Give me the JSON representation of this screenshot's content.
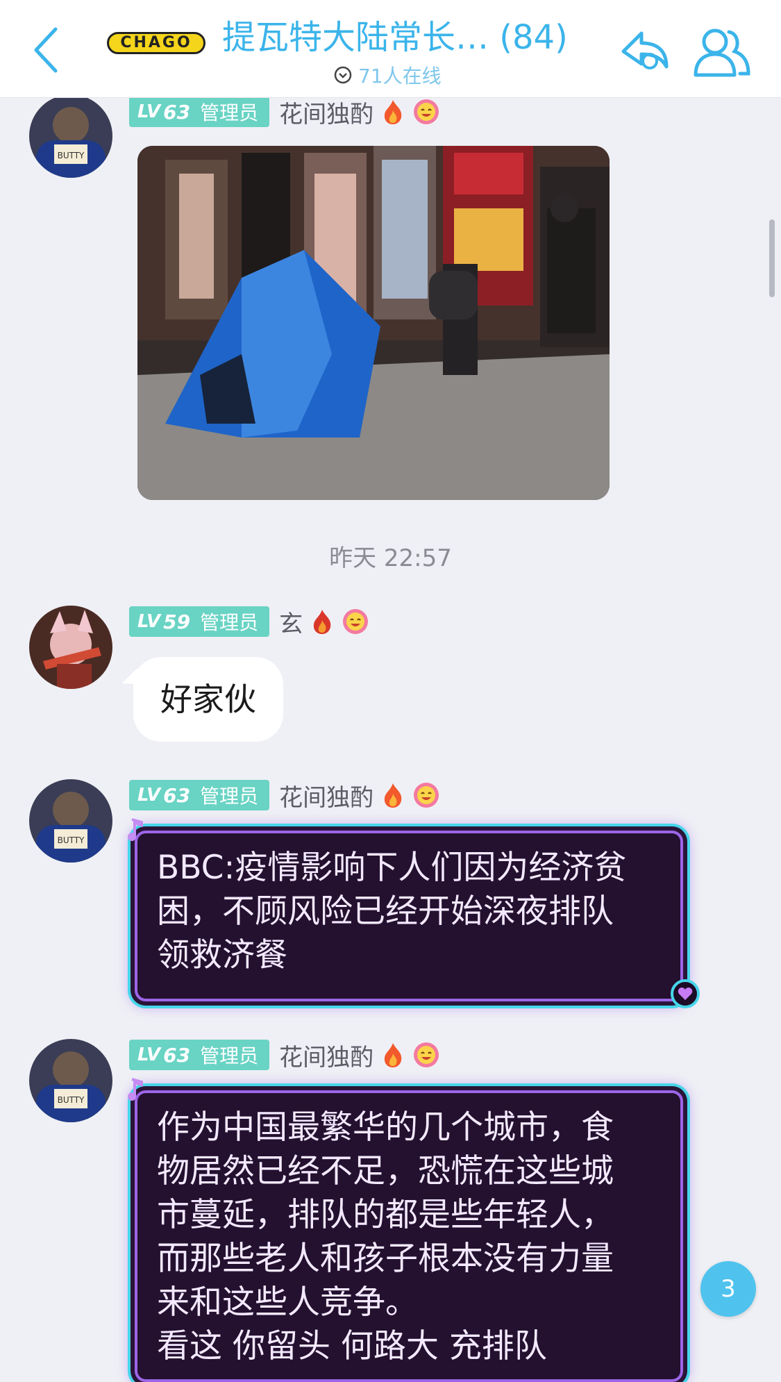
{
  "header": {
    "logo_text": "CHAGO",
    "title": "提瓦特大陆常长… (84)",
    "online": "71人在线"
  },
  "messages": [
    {
      "level_prefix": "LV",
      "level": "63",
      "role": "管理员",
      "nickname": "花间独酌",
      "type": "image"
    },
    {
      "level_prefix": "LV",
      "level": "59",
      "role": "管理员",
      "nickname": "玄",
      "text": "好家伙"
    },
    {
      "level_prefix": "LV",
      "level": "63",
      "role": "管理员",
      "nickname": "花间独酌",
      "text_lines": [
        "BBC:疫情影响下人们因为经济贫",
        "困，不顾风险已经开始深夜排队",
        "领救济餐"
      ]
    },
    {
      "level_prefix": "LV",
      "level": "63",
      "role": "管理员",
      "nickname": "花间独酌",
      "text_lines": [
        "作为中国最繁华的几个城市，食",
        "物居然已经不足，恐慌在这些城",
        "市蔓延，排队的都是些年轻人，",
        "而那些老人和孩子根本没有力量",
        "来和这些人竞争。",
        "看这 你留头 何路大 充排队"
      ]
    }
  ],
  "timestamp": "昨天 22:57",
  "unread_count": "3",
  "colors": {
    "accent": "#3bb4ea",
    "level_badge": "#69d3c4",
    "neon_border": "#47d6ea",
    "neon_bg": "#24102f"
  },
  "icons": [
    "back-arrow-icon",
    "share-icon",
    "members-icon",
    "check-circle-icon",
    "fire-icon",
    "smiley-flower-icon",
    "music-note-icon",
    "heart-icon"
  ]
}
